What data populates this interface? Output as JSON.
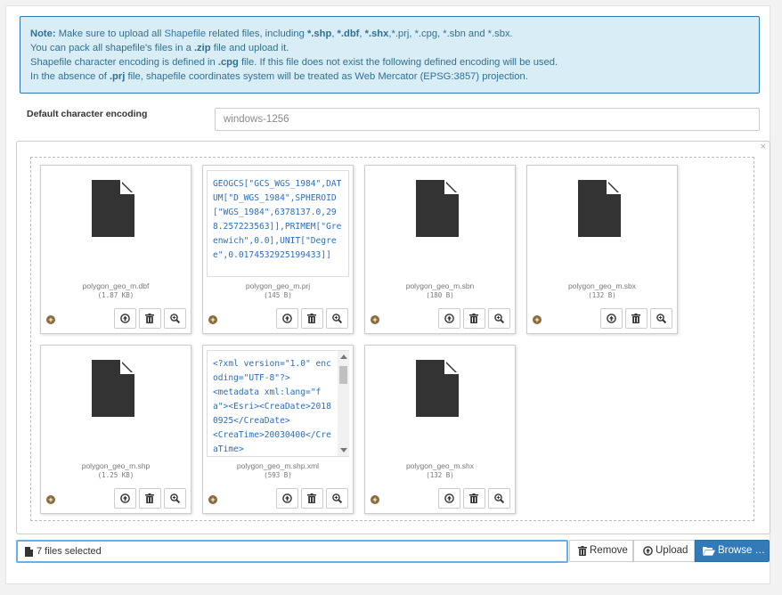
{
  "note": {
    "line1": {
      "prefix": "Note:",
      "t1": " Make sure to upload all ",
      "link": "Shapefile",
      "t2": " related files, including ",
      "e1": "*.shp",
      "c1": ", ",
      "e2": "*.dbf",
      "c2": ", ",
      "e3": "*.shx",
      "rest": ",*.prj, *.cpg, *.sbn and *.sbx."
    },
    "line2": {
      "t1": "You can pack all shapefile's files in a ",
      "b1": ".zip",
      "t2": " file and upload it."
    },
    "line3": {
      "t1": "Shapefile character encoding is defined in ",
      "b1": ".cpg",
      "t2": " file. If this file does not exist the following defined encoding will be used."
    },
    "line4": {
      "t1": "In the absence of ",
      "b1": ".prj",
      "t2": " file, shapefile coordinates system will be treated as Web Mercator (EPSG:3857) projection."
    }
  },
  "encoding": {
    "label": "Default character encoding",
    "value": "windows-1256"
  },
  "dropzone": {
    "close_symbol": "×"
  },
  "files": [
    {
      "name": "polygon_geo_m.dbf",
      "size": "(1.87 KB)",
      "preview": null
    },
    {
      "name": "polygon_geo_m.prj",
      "size": "(145 B)",
      "preview": "GEOGCS[\"GCS_WGS_1984\",DATUM[\"D_WGS_1984\",SPHEROID[\"WGS_1984\",6378137.0,298.257223563]],PRIMEM[\"Greenwich\",0.0],UNIT[\"Degree\",0.0174532925199433]]"
    },
    {
      "name": "polygon_geo_m.sbn",
      "size": "(180 B)",
      "preview": null
    },
    {
      "name": "polygon_geo_m.sbx",
      "size": "(132 B)",
      "preview": null
    },
    {
      "name": "polygon_geo_m.shp",
      "size": "(1.25 KB)",
      "preview": null
    },
    {
      "name": "polygon_geo_m.shp.xml",
      "size": "(593 B)",
      "preview": "<?xml version=\"1.0\" encoding=\"UTF-8\"?>\n<metadata xml:lang=\"fa\"><Esri><CreaDate>20180925</CreaDate>\n<CreaTime>20030400</CreaTime>"
    },
    {
      "name": "polygon_geo_m.shx",
      "size": "(132 B)",
      "preview": null
    }
  ],
  "caption": {
    "text": "7 files selected"
  },
  "buttons": {
    "remove": "Remove",
    "upload": "Upload",
    "browse": "Browse …"
  },
  "colors": {
    "primary": "#337ab7",
    "info_bg": "#d9edf7",
    "info_border": "#2a7ab0",
    "drag_handle": "#8a6d3b"
  },
  "icons": {
    "file": "file-icon",
    "upload": "upload-icon",
    "delete": "trash-icon",
    "zoom": "zoom-icon",
    "drag": "drag-handle-icon",
    "remove": "trash-icon",
    "browse": "folder-open-icon"
  }
}
